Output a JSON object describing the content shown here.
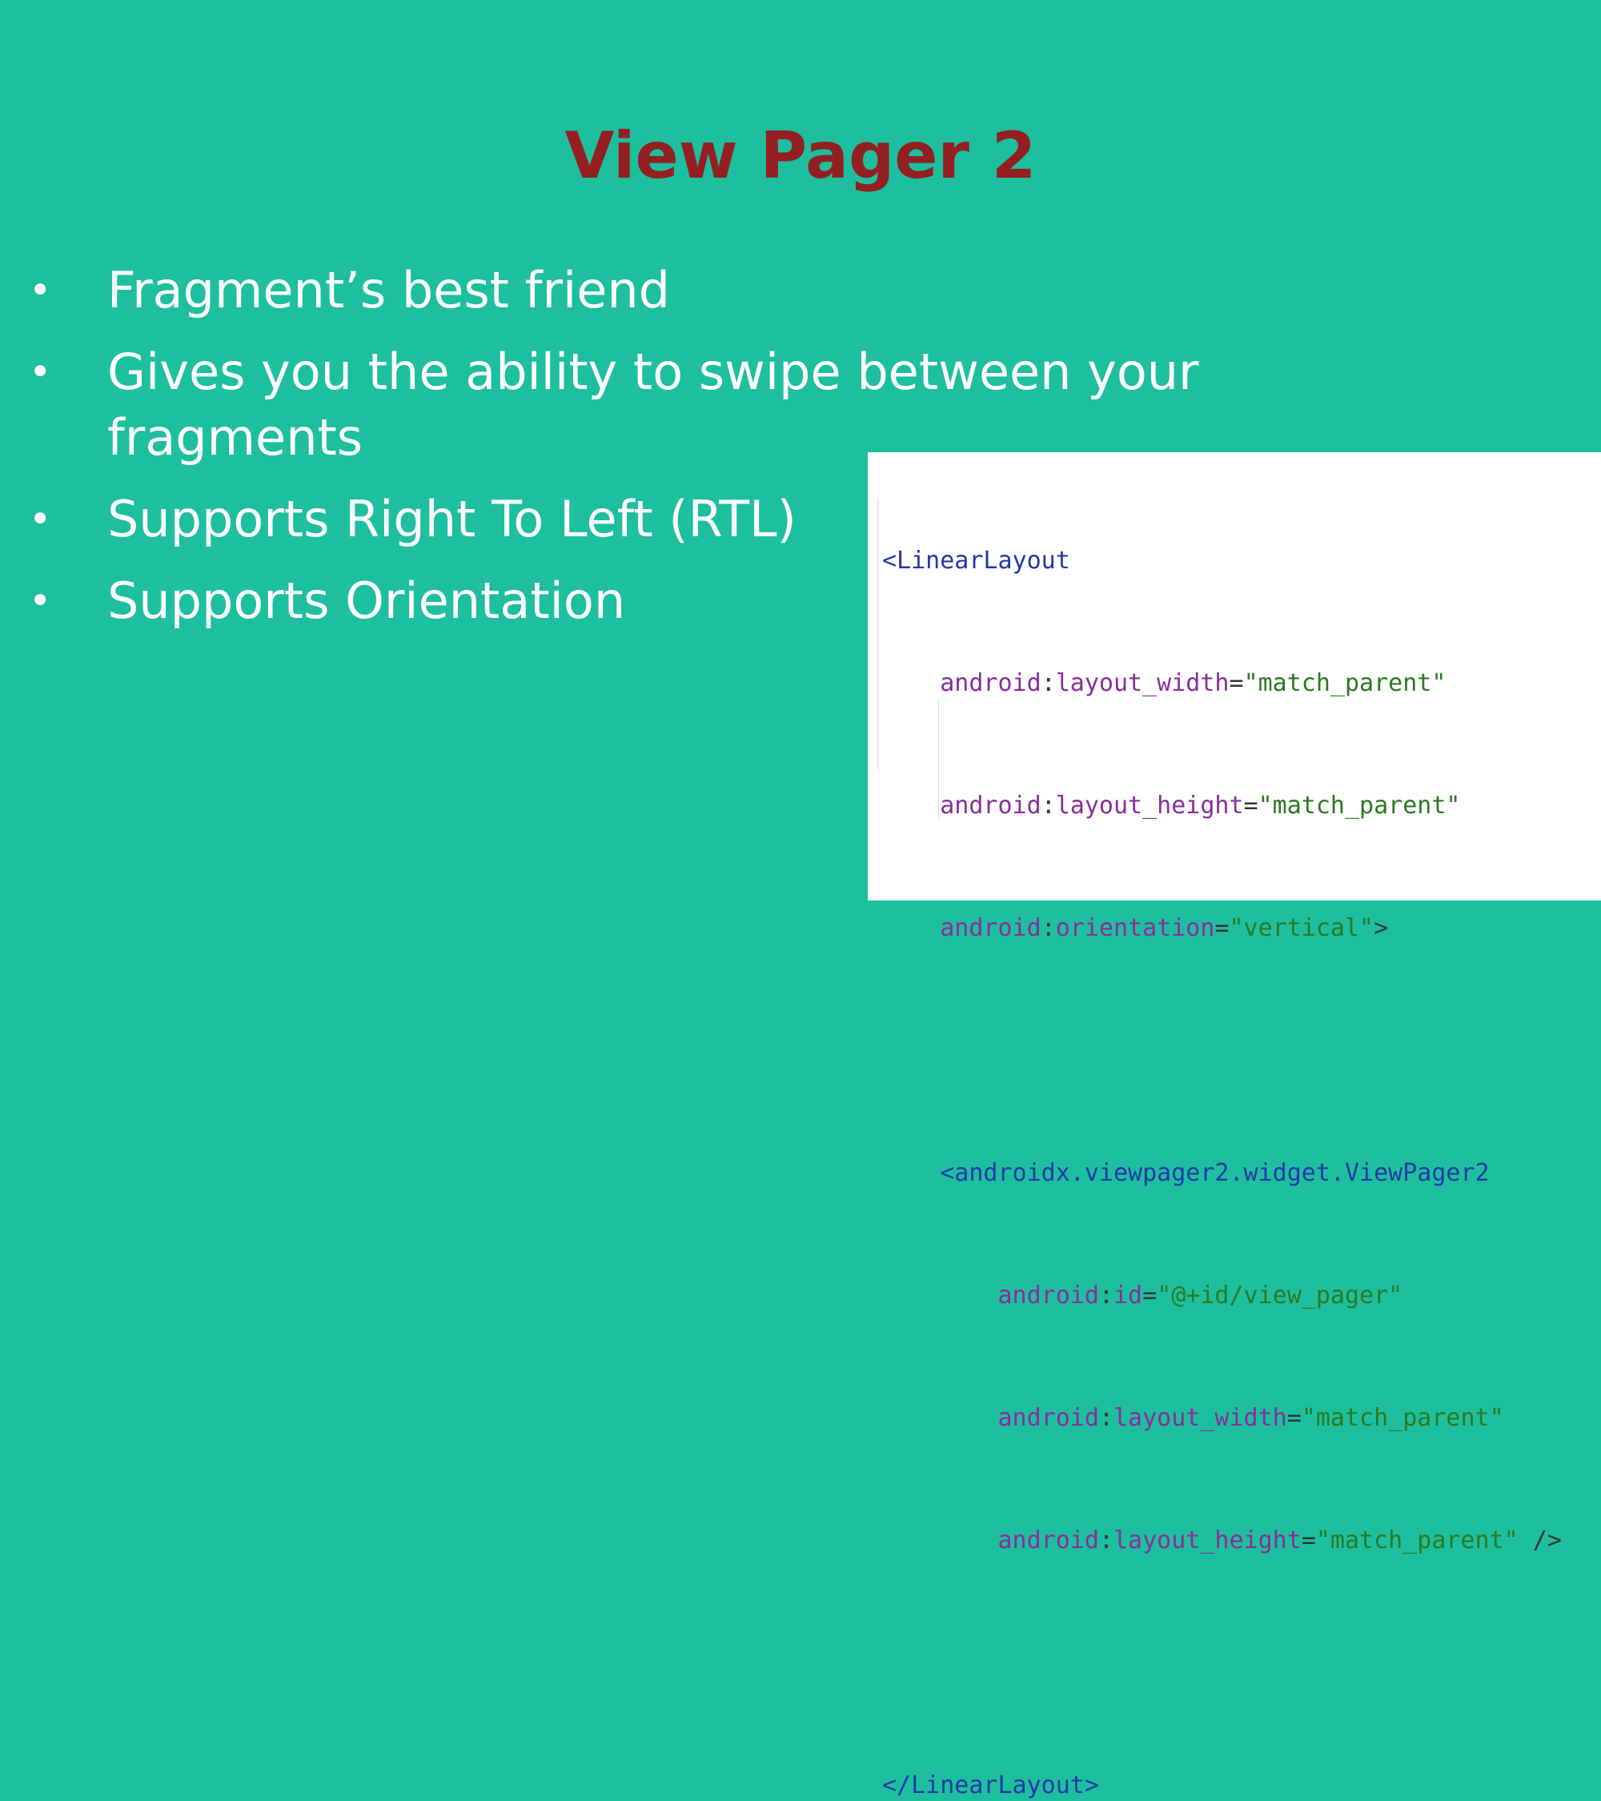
{
  "slide": {
    "title": "View Pager 2",
    "bullets": [
      "Fragment’s best friend",
      "Gives you the ability to swipe between your fragments",
      "Supports Right To Left (RTL)",
      "Supports Orientation"
    ],
    "bullet_glyph": "•"
  },
  "code": {
    "outer_open": "<LinearLayout",
    "outer_attrs": [
      {
        "ns": "android",
        "name": "layout_width",
        "value": "\"match_parent\"",
        "suffix": ""
      },
      {
        "ns": "android",
        "name": "layout_height",
        "value": "\"match_parent\"",
        "suffix": ""
      },
      {
        "ns": "android",
        "name": "orientation",
        "value": "\"vertical\"",
        "suffix": ">"
      }
    ],
    "inner_open": "<androidx.viewpager2.widget.ViewPager2",
    "inner_attrs": [
      {
        "ns": "android",
        "name": "id",
        "value": "\"@+id/view_pager\"",
        "suffix": ""
      },
      {
        "ns": "android",
        "name": "layout_width",
        "value": "\"match_parent\"",
        "suffix": ""
      },
      {
        "ns": "android",
        "name": "layout_height",
        "value": "\"match_parent\"",
        "suffix": " />"
      }
    ],
    "outer_close": "</LinearLayout>"
  },
  "colors": {
    "background": "#1dbf9f",
    "title": "#931f22",
    "text": "#ffffff"
  }
}
